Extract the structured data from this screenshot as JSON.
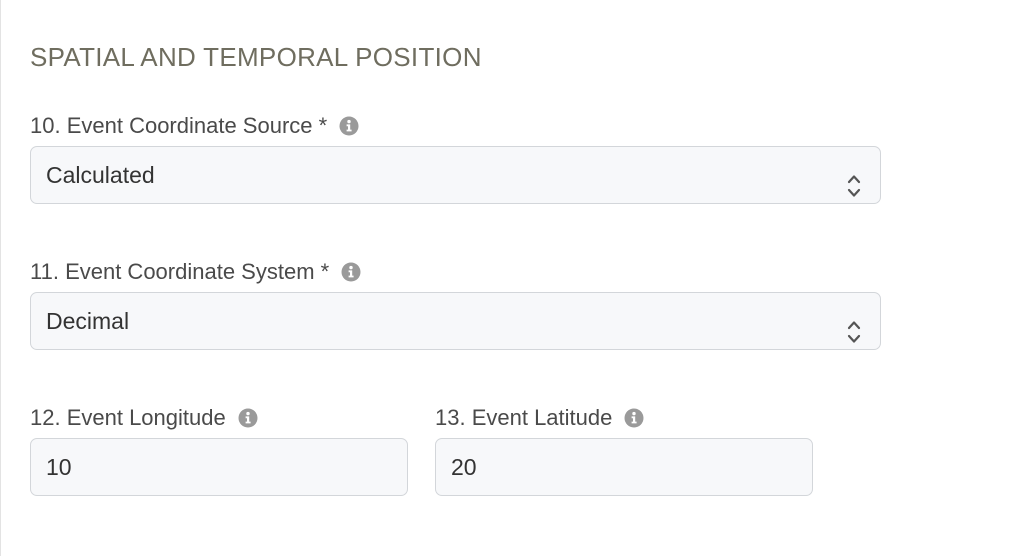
{
  "section": {
    "title": "SPATIAL AND TEMPORAL POSITION"
  },
  "fields": {
    "coordinate_source": {
      "label": "10. Event Coordinate Source *",
      "value": "Calculated",
      "info_icon": "info-circle-icon"
    },
    "coordinate_system": {
      "label": "11. Event Coordinate System *",
      "value": "Decimal",
      "info_icon": "info-circle-icon"
    },
    "longitude": {
      "label": "12. Event Longitude",
      "value": "10",
      "info_icon": "info-circle-icon"
    },
    "latitude": {
      "label": "13. Event Latitude",
      "value": "20",
      "info_icon": "info-circle-icon"
    }
  },
  "colors": {
    "section_title": "#6f6d5f",
    "label_text": "#4a4a4a",
    "control_background": "#f7f8fa",
    "control_border": "#d3d6da",
    "info_icon": "#9a9a9a"
  }
}
